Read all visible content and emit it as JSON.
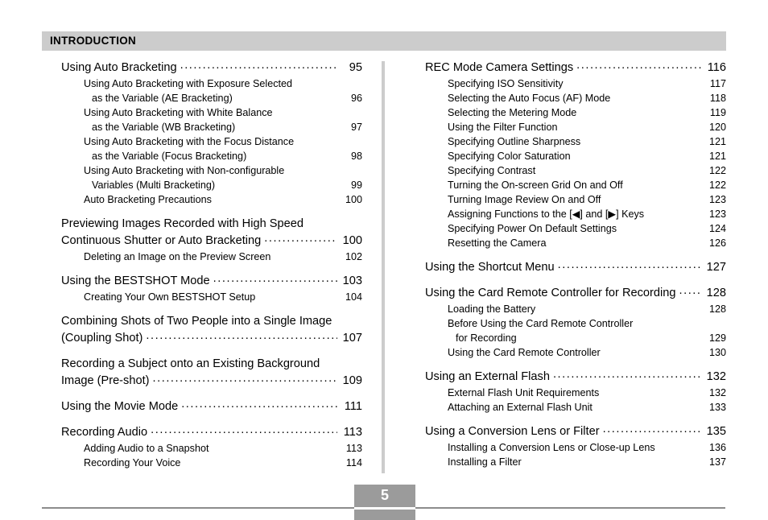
{
  "header": {
    "section_label": "INTRODUCTION",
    "band_color": "#cccccc"
  },
  "footer": {
    "page_number": "5",
    "page_box_color": "#9b9b9b",
    "rule_color": "#8c8c8c"
  },
  "divider": {
    "color": "#cccccc"
  },
  "columns": {
    "left": [
      {
        "level": 1,
        "lines": [
          {
            "title": "Using Auto Bracketing",
            "page": "95",
            "dots": true
          }
        ]
      },
      {
        "level": 2,
        "lines": [
          {
            "title": "Using Auto Bracketing with Exposure Selected",
            "page": "",
            "dots": false
          },
          {
            "title": "as the Variable (AE Bracketing)",
            "page": "96",
            "dots": false,
            "cont": true
          }
        ]
      },
      {
        "level": 2,
        "lines": [
          {
            "title": "Using Auto Bracketing with White Balance",
            "page": "",
            "dots": false
          },
          {
            "title": "as the Variable (WB Bracketing)",
            "page": "97",
            "dots": false,
            "cont": true
          }
        ]
      },
      {
        "level": 2,
        "lines": [
          {
            "title": "Using Auto Bracketing with the Focus Distance",
            "page": "",
            "dots": false
          },
          {
            "title": "as the Variable (Focus Bracketing)",
            "page": "98",
            "dots": false,
            "cont": true
          }
        ]
      },
      {
        "level": 2,
        "lines": [
          {
            "title": "Using Auto Bracketing with Non-configurable",
            "page": "",
            "dots": false
          },
          {
            "title": "Variables (Multi Bracketing)",
            "page": "99",
            "dots": false,
            "cont": true
          }
        ]
      },
      {
        "level": 2,
        "lines": [
          {
            "title": "Auto Bracketing Precautions",
            "page": "100",
            "dots": false
          }
        ]
      },
      {
        "level": 1,
        "lines": [
          {
            "title": "Previewing Images Recorded with High Speed",
            "page": "",
            "dots": false
          },
          {
            "title": "Continuous Shutter or Auto Bracketing",
            "page": "100",
            "dots": true,
            "cont": true
          }
        ]
      },
      {
        "level": 2,
        "lines": [
          {
            "title": "Deleting an Image on the Preview Screen",
            "page": "102",
            "dots": false
          }
        ]
      },
      {
        "level": 1,
        "lines": [
          {
            "title": "Using the BESTSHOT Mode",
            "page": "103",
            "dots": true
          }
        ]
      },
      {
        "level": 2,
        "lines": [
          {
            "title": "Creating Your Own BESTSHOT Setup",
            "page": "104",
            "dots": false
          }
        ]
      },
      {
        "level": 1,
        "lines": [
          {
            "title": "Combining Shots of Two People into a Single Image",
            "page": "",
            "dots": false
          },
          {
            "title": "(Coupling Shot)",
            "page": "107",
            "dots": true,
            "cont": true
          }
        ]
      },
      {
        "level": 1,
        "lines": [
          {
            "title": "Recording a Subject onto an Existing Background",
            "page": "",
            "dots": false
          },
          {
            "title": "Image (Pre-shot)",
            "page": "109",
            "dots": true,
            "cont": true
          }
        ]
      },
      {
        "level": 1,
        "lines": [
          {
            "title": "Using the Movie Mode",
            "page": "111",
            "dots": true
          }
        ]
      },
      {
        "level": 1,
        "lines": [
          {
            "title": "Recording Audio",
            "page": "113",
            "dots": true
          }
        ]
      },
      {
        "level": 2,
        "lines": [
          {
            "title": "Adding Audio to a Snapshot",
            "page": "113",
            "dots": false
          }
        ]
      },
      {
        "level": 2,
        "lines": [
          {
            "title": "Recording Your Voice",
            "page": "114",
            "dots": false
          }
        ]
      }
    ],
    "right": [
      {
        "level": 1,
        "lines": [
          {
            "title": "REC Mode Camera Settings",
            "page": "116",
            "dots": true
          }
        ]
      },
      {
        "level": 2,
        "lines": [
          {
            "title": "Specifying ISO Sensitivity",
            "page": "117",
            "dots": false
          }
        ]
      },
      {
        "level": 2,
        "lines": [
          {
            "title": "Selecting the Auto Focus (AF) Mode",
            "page": "118",
            "dots": false
          }
        ]
      },
      {
        "level": 2,
        "lines": [
          {
            "title": "Selecting the Metering Mode",
            "page": "119",
            "dots": false
          }
        ]
      },
      {
        "level": 2,
        "lines": [
          {
            "title": "Using the Filter Function",
            "page": "120",
            "dots": false
          }
        ]
      },
      {
        "level": 2,
        "lines": [
          {
            "title": "Specifying Outline Sharpness",
            "page": "121",
            "dots": false
          }
        ]
      },
      {
        "level": 2,
        "lines": [
          {
            "title": "Specifying Color Saturation",
            "page": "121",
            "dots": false
          }
        ]
      },
      {
        "level": 2,
        "lines": [
          {
            "title": "Specifying Contrast",
            "page": "122",
            "dots": false
          }
        ]
      },
      {
        "level": 2,
        "lines": [
          {
            "title": "Turning the On-screen Grid On and Off",
            "page": "122",
            "dots": false
          }
        ]
      },
      {
        "level": 2,
        "lines": [
          {
            "title": "Turning Image Review On and Off",
            "page": "123",
            "dots": false
          }
        ]
      },
      {
        "level": 2,
        "lines": [
          {
            "title": "Assigning Functions to the [◀] and [▶] Keys",
            "page": "123",
            "dots": false
          }
        ]
      },
      {
        "level": 2,
        "lines": [
          {
            "title": "Specifying Power On Default Settings",
            "page": "124",
            "dots": false
          }
        ]
      },
      {
        "level": 2,
        "lines": [
          {
            "title": "Resetting the Camera",
            "page": "126",
            "dots": false
          }
        ]
      },
      {
        "level": 1,
        "lines": [
          {
            "title": "Using the Shortcut Menu",
            "page": "127",
            "dots": true
          }
        ]
      },
      {
        "level": 1,
        "lines": [
          {
            "title": "Using the Card Remote Controller for Recording",
            "page": "128",
            "dots": true
          }
        ]
      },
      {
        "level": 2,
        "lines": [
          {
            "title": "Loading the Battery",
            "page": "128",
            "dots": false
          }
        ]
      },
      {
        "level": 2,
        "lines": [
          {
            "title": "Before Using the Card Remote Controller",
            "page": "",
            "dots": false
          },
          {
            "title": "for Recording",
            "page": "129",
            "dots": false,
            "cont": true
          }
        ]
      },
      {
        "level": 2,
        "lines": [
          {
            "title": "Using the Card Remote Controller",
            "page": "130",
            "dots": false
          }
        ]
      },
      {
        "level": 1,
        "lines": [
          {
            "title": "Using an External Flash",
            "page": "132",
            "dots": true
          }
        ]
      },
      {
        "level": 2,
        "lines": [
          {
            "title": "External Flash Unit Requirements",
            "page": "132",
            "dots": false
          }
        ]
      },
      {
        "level": 2,
        "lines": [
          {
            "title": "Attaching an External Flash Unit",
            "page": "133",
            "dots": false
          }
        ]
      },
      {
        "level": 1,
        "lines": [
          {
            "title": "Using a Conversion Lens or Filter",
            "page": "135",
            "dots": true
          }
        ]
      },
      {
        "level": 2,
        "lines": [
          {
            "title": "Installing a Conversion Lens or Close-up Lens",
            "page": "136",
            "dots": false
          }
        ]
      },
      {
        "level": 2,
        "lines": [
          {
            "title": "Installing a Filter",
            "page": "137",
            "dots": false
          }
        ]
      }
    ]
  }
}
